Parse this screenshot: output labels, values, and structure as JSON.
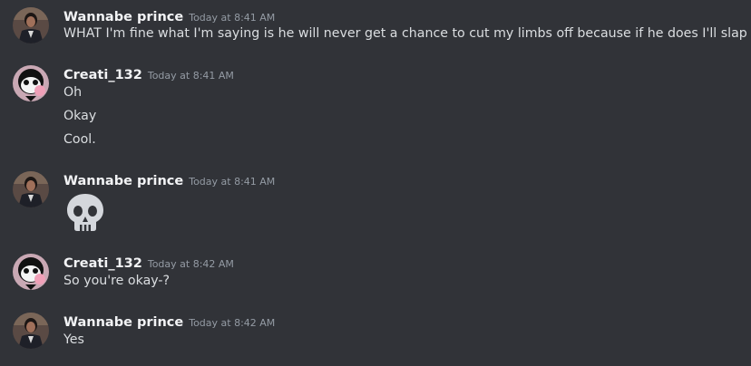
{
  "messages": [
    {
      "author": "Wannabe prince",
      "time": "Today at 8:41 AM",
      "lines": [
        "WHAT I'm fine what I'm saying is he will never get a chance to cut my limbs off because if he does I'll slap him"
      ],
      "avatar_icon": "dark-suited-person-avatar"
    },
    {
      "author": "Creati_132",
      "time": "Today at 8:41 AM",
      "lines": [
        "Oh",
        "Okay",
        "Cool."
      ],
      "avatar_icon": "cartoon-bubblegum-avatar"
    },
    {
      "author": "Wannabe prince",
      "time": "Today at 8:41 AM",
      "emoji": "skull-emoji",
      "avatar_icon": "dark-suited-person-avatar"
    },
    {
      "author": "Creati_132",
      "time": "Today at 8:42 AM",
      "lines": [
        "So you're okay-?"
      ],
      "avatar_icon": "cartoon-bubblegum-avatar"
    },
    {
      "author": "Wannabe prince",
      "time": "Today at 8:42 AM",
      "lines": [
        "Yes"
      ],
      "avatar_icon": "dark-suited-person-avatar"
    }
  ],
  "colors": {
    "background": "#313338",
    "username": "#f2f3f5",
    "timestamp": "#949ba4",
    "text": "#dbdee1",
    "accent_pink": "#f0a0b8"
  }
}
